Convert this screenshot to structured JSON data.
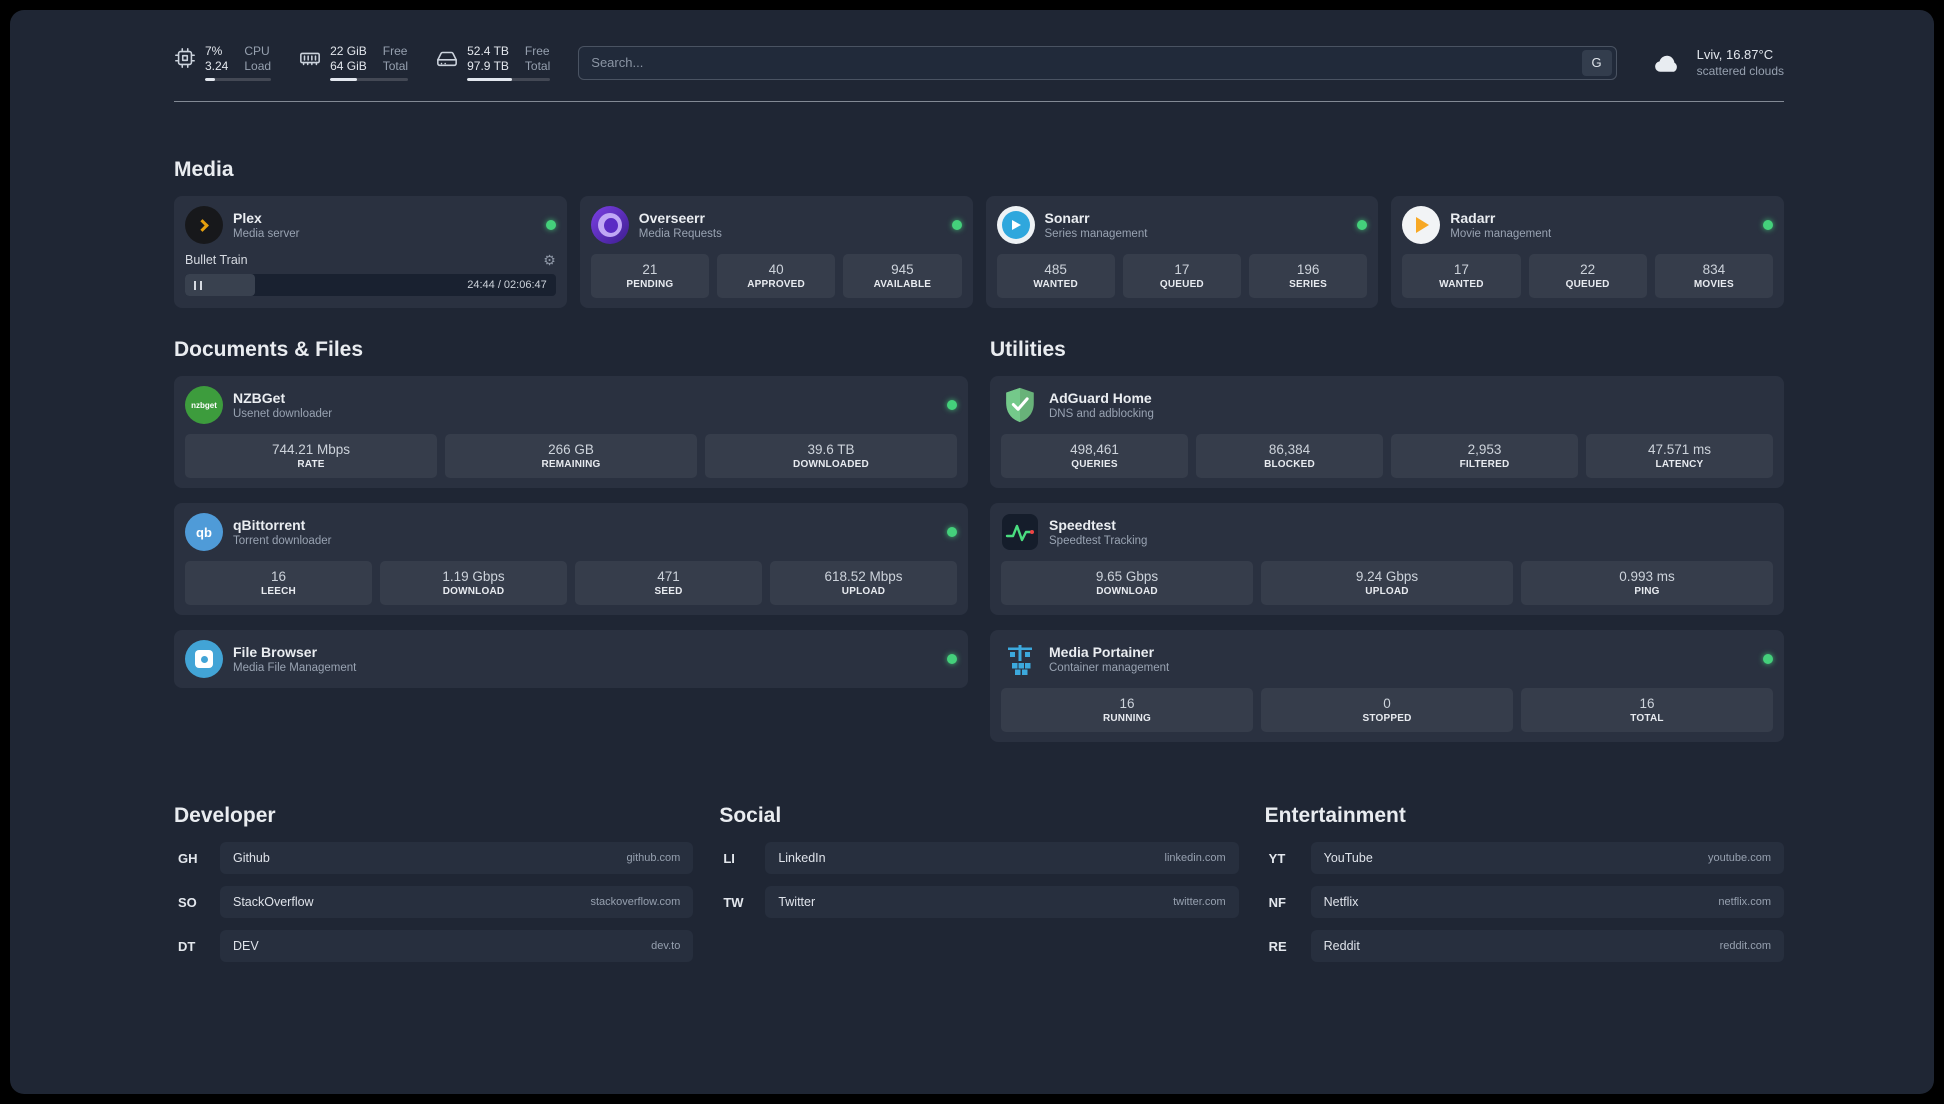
{
  "colors": {
    "status_green": "#44d07b",
    "background": "#1f2634",
    "card": "#2a3140",
    "plex_amber": "#e6a00e"
  },
  "topbar": {
    "cpu": {
      "value1": "7%",
      "value2": "3.24",
      "label1": "CPU",
      "label2": "Load",
      "bar_percent": 15
    },
    "memory": {
      "value1": "22 GiB",
      "value2": "64 GiB",
      "label1": "Free",
      "label2": "Total",
      "bar_percent": 34
    },
    "disk": {
      "value1": "52.4 TB",
      "value2": "97.9 TB",
      "label1": "Free",
      "label2": "Total",
      "bar_percent": 54
    },
    "search": {
      "placeholder": "Search...",
      "engine_label": "G"
    },
    "weather": {
      "location": "Lviv, 16.87°C",
      "condition": "scattered clouds"
    }
  },
  "sections": {
    "media": "Media",
    "documents": "Documents & Files",
    "utilities": "Utilities",
    "developer": "Developer",
    "social": "Social",
    "entertainment": "Entertainment"
  },
  "apps": {
    "plex": {
      "name": "Plex",
      "subtitle": "Media server",
      "now_playing": "Bullet Train",
      "time": "24:44 / 02:06:47",
      "progress_percent": 19,
      "gear": "⚙"
    },
    "overseerr": {
      "name": "Overseerr",
      "subtitle": "Media Requests",
      "stats": [
        {
          "value": "21",
          "label": "PENDING"
        },
        {
          "value": "40",
          "label": "APPROVED"
        },
        {
          "value": "945",
          "label": "AVAILABLE"
        }
      ]
    },
    "sonarr": {
      "name": "Sonarr",
      "subtitle": "Series management",
      "stats": [
        {
          "value": "485",
          "label": "WANTED"
        },
        {
          "value": "17",
          "label": "QUEUED"
        },
        {
          "value": "196",
          "label": "SERIES"
        }
      ]
    },
    "radarr": {
      "name": "Radarr",
      "subtitle": "Movie management",
      "stats": [
        {
          "value": "17",
          "label": "WANTED"
        },
        {
          "value": "22",
          "label": "QUEUED"
        },
        {
          "value": "834",
          "label": "MOVIES"
        }
      ]
    },
    "nzbget": {
      "name": "NZBGet",
      "subtitle": "Usenet downloader",
      "icon_text": "nzbget",
      "stats": [
        {
          "value": "744.21 Mbps",
          "label": "RATE"
        },
        {
          "value": "266 GB",
          "label": "REMAINING"
        },
        {
          "value": "39.6 TB",
          "label": "DOWNLOADED"
        }
      ]
    },
    "qbittorrent": {
      "name": "qBittorrent",
      "subtitle": "Torrent downloader",
      "icon_text": "qb",
      "stats": [
        {
          "value": "16",
          "label": "LEECH"
        },
        {
          "value": "1.19 Gbps",
          "label": "DOWNLOAD"
        },
        {
          "value": "471",
          "label": "SEED"
        },
        {
          "value": "618.52 Mbps",
          "label": "UPLOAD"
        }
      ]
    },
    "filebrowser": {
      "name": "File Browser",
      "subtitle": "Media File Management"
    },
    "adguard": {
      "name": "AdGuard Home",
      "subtitle": "DNS and adblocking",
      "stats": [
        {
          "value": "498,461",
          "label": "QUERIES"
        },
        {
          "value": "86,384",
          "label": "BLOCKED"
        },
        {
          "value": "2,953",
          "label": "FILTERED"
        },
        {
          "value": "47.571 ms",
          "label": "LATENCY"
        }
      ]
    },
    "speedtest": {
      "name": "Speedtest",
      "subtitle": "Speedtest Tracking",
      "stats": [
        {
          "value": "9.65 Gbps",
          "label": "DOWNLOAD"
        },
        {
          "value": "9.24 Gbps",
          "label": "UPLOAD"
        },
        {
          "value": "0.993 ms",
          "label": "PING"
        }
      ]
    },
    "portainer": {
      "name": "Media Portainer",
      "subtitle": "Container management",
      "stats": [
        {
          "value": "16",
          "label": "RUNNING"
        },
        {
          "value": "0",
          "label": "STOPPED"
        },
        {
          "value": "16",
          "label": "TOTAL"
        }
      ]
    }
  },
  "bookmarks": {
    "developer": [
      {
        "abbr": "GH",
        "name": "Github",
        "domain": "github.com"
      },
      {
        "abbr": "SO",
        "name": "StackOverflow",
        "domain": "stackoverflow.com"
      },
      {
        "abbr": "DT",
        "name": "DEV",
        "domain": "dev.to"
      }
    ],
    "social": [
      {
        "abbr": "LI",
        "name": "LinkedIn",
        "domain": "linkedin.com"
      },
      {
        "abbr": "TW",
        "name": "Twitter",
        "domain": "twitter.com"
      }
    ],
    "entertainment": [
      {
        "abbr": "YT",
        "name": "YouTube",
        "domain": "youtube.com"
      },
      {
        "abbr": "NF",
        "name": "Netflix",
        "domain": "netflix.com"
      },
      {
        "abbr": "RE",
        "name": "Reddit",
        "domain": "reddit.com"
      }
    ]
  }
}
